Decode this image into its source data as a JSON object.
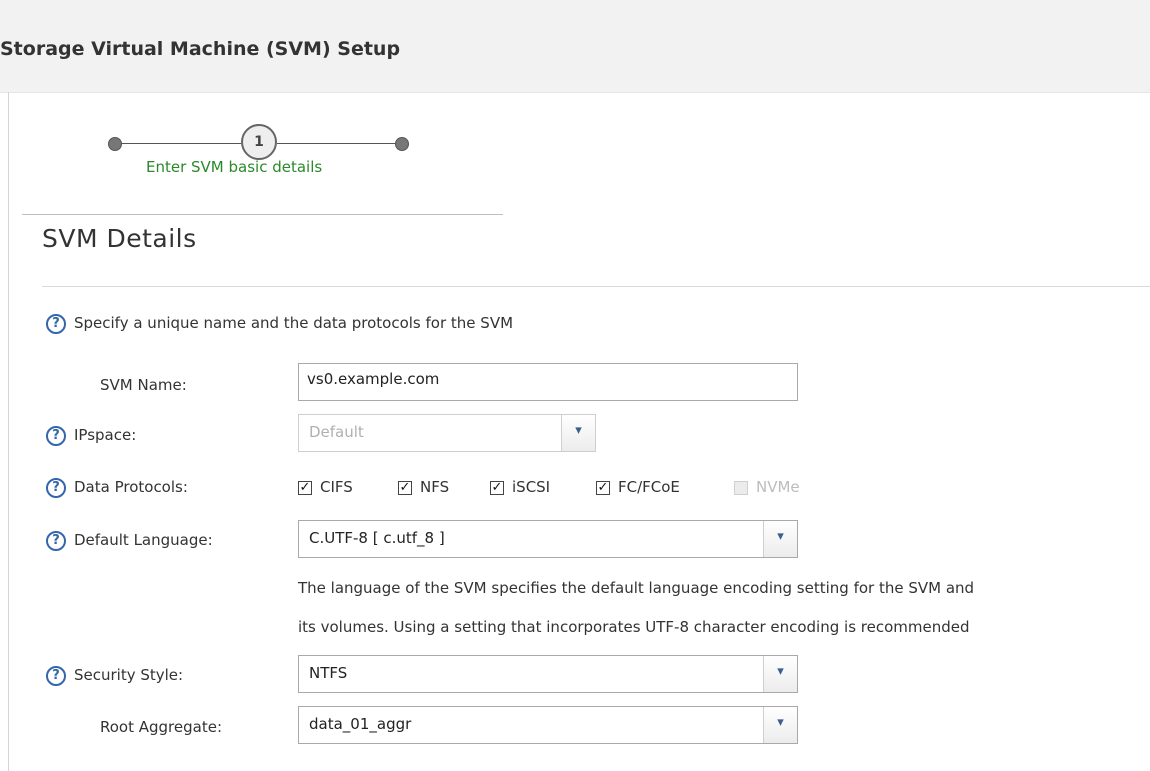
{
  "header": {
    "title": "Storage Virtual Machine (SVM) Setup"
  },
  "wizard": {
    "current_step": "1",
    "step_label": "Enter SVM basic details"
  },
  "section": {
    "title": "SVM Details",
    "intro": "Specify a unique name and the data protocols for the SVM"
  },
  "fields": {
    "svm_name": {
      "label": "SVM Name:",
      "value": "vs0.example.com"
    },
    "ipspace": {
      "label": "IPspace:",
      "value": "Default"
    },
    "data_protocols": {
      "label": "Data Protocols:",
      "options": [
        {
          "label": "CIFS",
          "checked": true,
          "enabled": true
        },
        {
          "label": "NFS",
          "checked": true,
          "enabled": true
        },
        {
          "label": "iSCSI",
          "checked": true,
          "enabled": true
        },
        {
          "label": "FC/FCoE",
          "checked": true,
          "enabled": true
        },
        {
          "label": "NVMe",
          "checked": false,
          "enabled": false
        }
      ]
    },
    "default_language": {
      "label": "Default Language:",
      "value": "C.UTF-8 [ c.utf_8 ]",
      "note_line1": "The language of the SVM specifies the default language encoding setting for the SVM and",
      "note_line2": "its volumes. Using a setting that incorporates UTF-8 character encoding is recommended"
    },
    "security_style": {
      "label": "Security Style:",
      "value": "NTFS"
    },
    "root_aggregate": {
      "label": "Root Aggregate:",
      "value": "data_01_aggr"
    }
  },
  "icons": {
    "help": "help-circle-icon",
    "dropdown": "chevron-down-icon",
    "check": "check-icon"
  },
  "glyphs": {
    "help": "?",
    "chevron": "▾",
    "check": "✓"
  },
  "colors": {
    "accent_blue": "#3366aa",
    "step_label_green": "#2a8a2a",
    "header_bg": "#f2f2f2"
  }
}
